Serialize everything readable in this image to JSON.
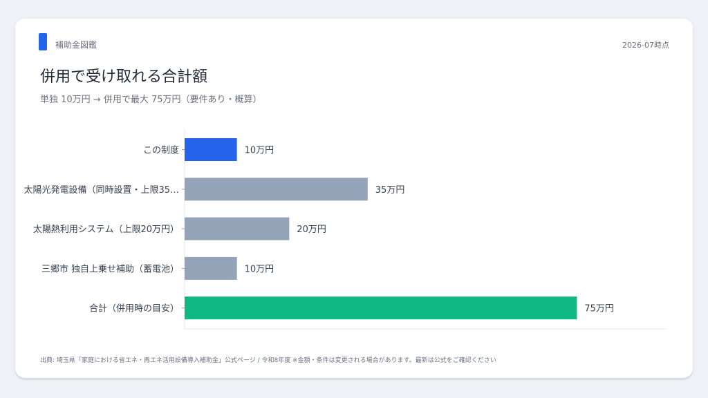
{
  "header": {
    "brand": "補助金図鑑",
    "date": "2026-07時点",
    "title": "併用で受け取れる合計額",
    "subtitle": "単独 10万円 → 併用で最大 75万円（要件あり・概算）"
  },
  "colors": {
    "primary": "#2563eb",
    "other": "#94a3b8",
    "total": "#10b981"
  },
  "chart_data": {
    "type": "bar",
    "orientation": "horizontal",
    "categories": [
      "この制度",
      "太陽光発電設備（同時設置・上限35…",
      "太陽熱利用システム（上限20万円）",
      "三郷市 独自上乗せ補助（蓄電池）",
      "合計（併用時の目安）"
    ],
    "values": [
      10,
      35,
      20,
      10,
      75
    ],
    "value_labels": [
      "10万円",
      "35万円",
      "20万円",
      "10万円",
      "75万円"
    ],
    "bar_colors": [
      "#2563eb",
      "#94a3b8",
      "#94a3b8",
      "#94a3b8",
      "#10b981"
    ],
    "unit": "万円",
    "xlim": [
      0,
      92
    ]
  },
  "footnote": "出典: 埼玉県「家庭における省エネ・再エネ活用設備導入補助金」公式ページ / 令和8年度 ※金額・条件は変更される場合があります。最新は公式をご確認ください"
}
